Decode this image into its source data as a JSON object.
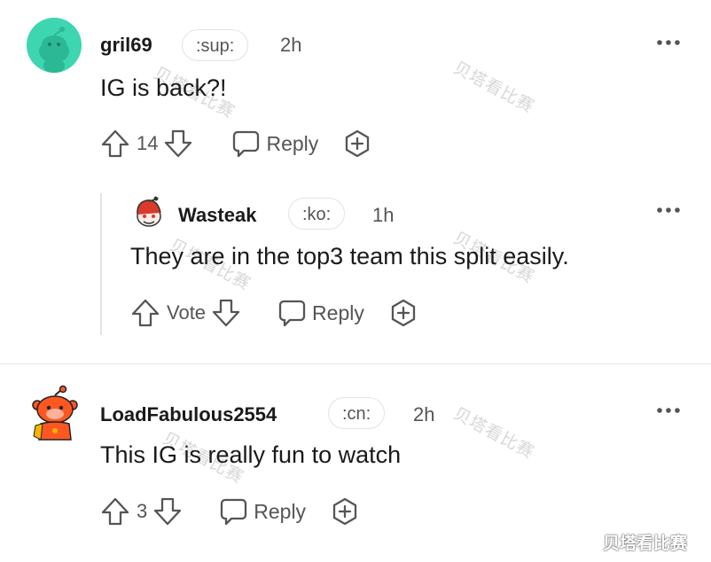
{
  "comments": [
    {
      "username": "gril69",
      "flair": ":sup:",
      "time": "2h",
      "text": "IG is back?!",
      "vote_count": "14",
      "reply_label": "Reply"
    },
    {
      "username": "Wasteak",
      "flair": ":ko:",
      "time": "1h",
      "text": "They are in the top3 team this split easily.",
      "vote_count": "Vote",
      "reply_label": "Reply"
    },
    {
      "username": "LoadFabulous2554",
      "flair": ":cn:",
      "time": "2h",
      "text": "This IG is really fun to watch",
      "vote_count": "3",
      "reply_label": "Reply"
    }
  ],
  "watermark": "贝塔看比赛",
  "icons": {
    "upvote": "arrow-up-icon",
    "downvote": "arrow-down-icon",
    "reply": "speech-bubble-icon",
    "award": "plus-circle-icon",
    "more": "ellipsis-icon"
  },
  "colors": {
    "avatar1_bg": "#3dd6b0",
    "avatar3_body": "#ff5722",
    "text": "#1a1a1b",
    "muted": "#555555"
  }
}
